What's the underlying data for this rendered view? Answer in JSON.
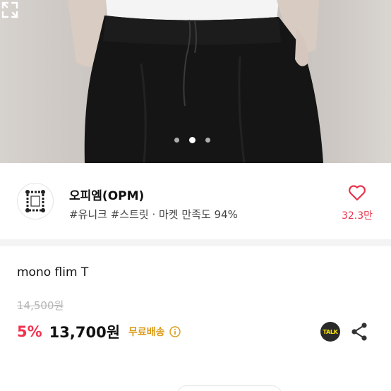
{
  "carousel": {
    "total_slides": 3,
    "active_slide": 2
  },
  "seller": {
    "name": "오피엠(OPM)",
    "tags": "#유니크 #스트릿 · 마켓 만족도 94%",
    "like_count": "32.3만",
    "avatar_icon": "ornate-frame-logo-icon"
  },
  "product": {
    "title": "mono flim T",
    "original_price": "14,500원",
    "discount": "5%",
    "price": "13,700원",
    "shipping": "무료배송"
  },
  "actions": {
    "talk_label": "TALK",
    "share_icon": "share-icon",
    "like_icon": "heart-icon",
    "expand_icon": "expand-icon",
    "info_icon": "info-icon"
  },
  "colors": {
    "accent_red": "#f0324e",
    "like_red": "#e8334a",
    "shipping_gold": "#d99b1a",
    "talk_yellow": "#f9e000"
  }
}
